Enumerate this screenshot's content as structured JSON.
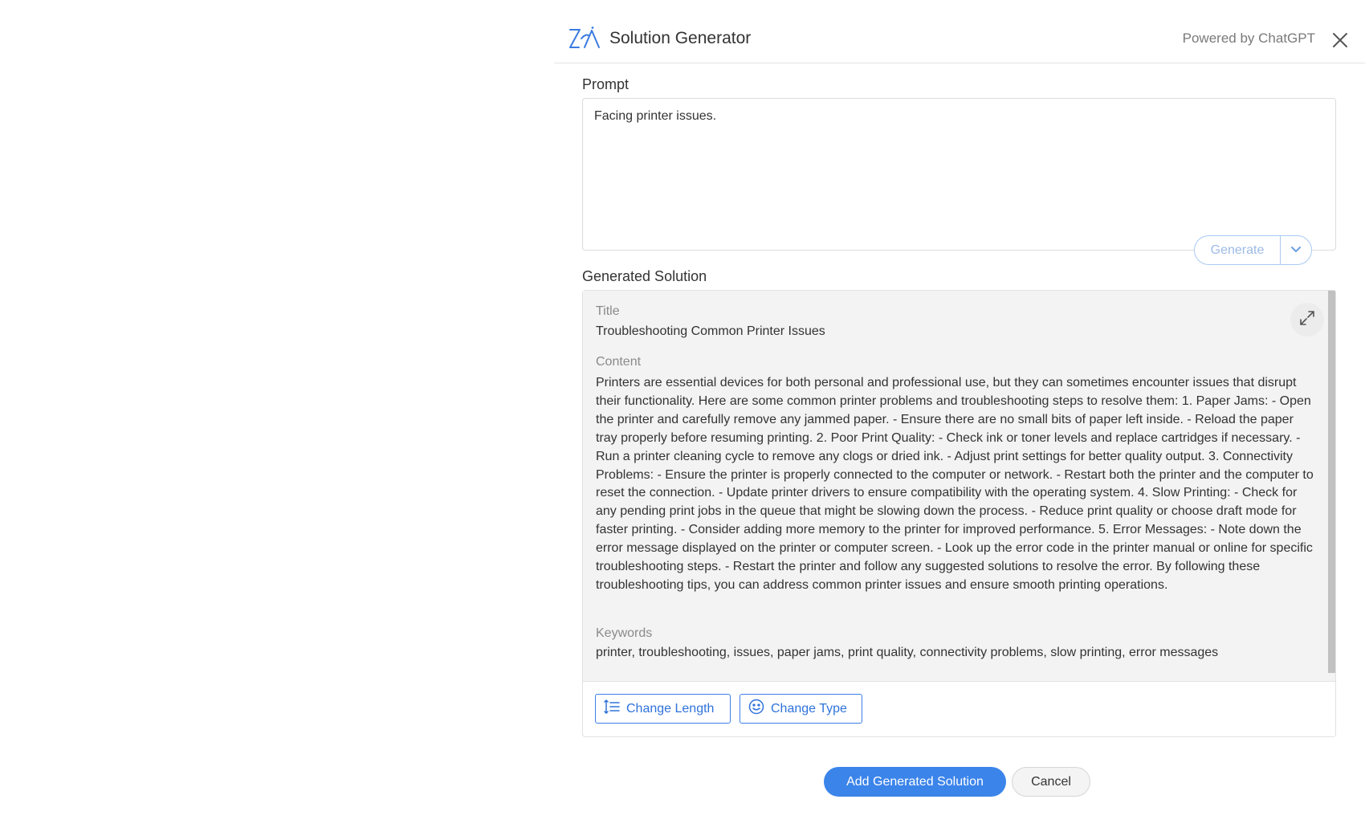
{
  "header": {
    "title": "Solution Generator",
    "powered_by": "Powered by ChatGPT"
  },
  "prompt": {
    "label": "Prompt",
    "value": "Facing printer issues.",
    "generate_label": "Generate"
  },
  "solution": {
    "label": "Generated Solution",
    "title_label": "Title",
    "title": "Troubleshooting Common Printer Issues",
    "content_label": "Content",
    "content": "Printers are essential devices for both personal and professional use, but they can sometimes encounter issues that disrupt their functionality. Here are some common printer problems and troubleshooting steps to resolve them: 1. Paper Jams: - Open the printer and carefully remove any jammed paper. - Ensure there are no small bits of paper left inside. - Reload the paper tray properly before resuming printing. 2. Poor Print Quality: - Check ink or toner levels and replace cartridges if necessary. - Run a printer cleaning cycle to remove any clogs or dried ink. - Adjust print settings for better quality output. 3. Connectivity Problems: - Ensure the printer is properly connected to the computer or network. - Restart both the printer and the computer to reset the connection. - Update printer drivers to ensure compatibility with the operating system. 4. Slow Printing: - Check for any pending print jobs in the queue that might be slowing down the process. - Reduce print quality or choose draft mode for faster printing. - Consider adding more memory to the printer for improved performance. 5. Error Messages: - Note down the error message displayed on the printer or computer screen. - Look up the error code in the printer manual or online for specific troubleshooting steps. - Restart the printer and follow any suggested solutions to resolve the error. By following these troubleshooting tips, you can address common printer issues and ensure smooth printing operations.",
    "keywords_label": "Keywords",
    "keywords": "printer, troubleshooting, issues, paper jams, print quality, connectivity problems, slow printing, error messages",
    "change_length_label": "Change Length",
    "change_type_label": "Change Type"
  },
  "footer": {
    "add_label": "Add Generated Solution",
    "cancel_label": "Cancel"
  },
  "colors": {
    "accent": "#3b84ea",
    "accent_text": "#2f73db",
    "generate_disabled": "#9cbbe6"
  },
  "icons": [
    "zia-logo-icon",
    "close-icon",
    "chevron-down-icon",
    "expand-icon",
    "line-height-icon",
    "smiley-icon"
  ]
}
